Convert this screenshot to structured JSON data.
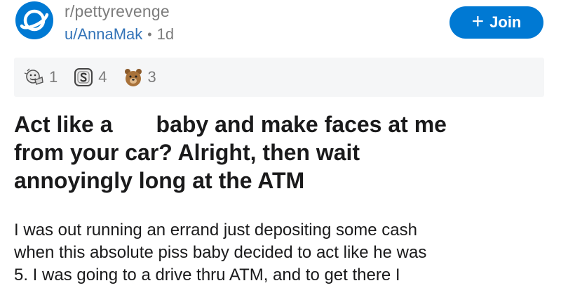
{
  "post": {
    "subreddit": "r/pettyrevenge",
    "author": "u/AnnaMak",
    "age": "1d",
    "join_label": "Join",
    "awards": [
      {
        "icon": "wholesome-award-icon",
        "count": "1"
      },
      {
        "icon": "silver-coin-award-icon",
        "count": "4"
      },
      {
        "icon": "bear-award-icon",
        "count": "3"
      }
    ],
    "title": {
      "line1_a": "Act like a",
      "line1_b": "baby and make faces at me",
      "line2": "from your car? Alright, then wait",
      "line3": "annoyingly long at the ATM"
    },
    "body": {
      "line1": "I was out running an errand just depositing some cash",
      "line2": "when this absolute piss baby decided to act like he was",
      "line3": "5. I was going to a drive thru ATM, and to get there I"
    }
  },
  "colors": {
    "brand": "#0079d3",
    "username": "#3474b8",
    "muted": "#7c7c7c",
    "award_bar_bg": "#f5f6f7"
  }
}
